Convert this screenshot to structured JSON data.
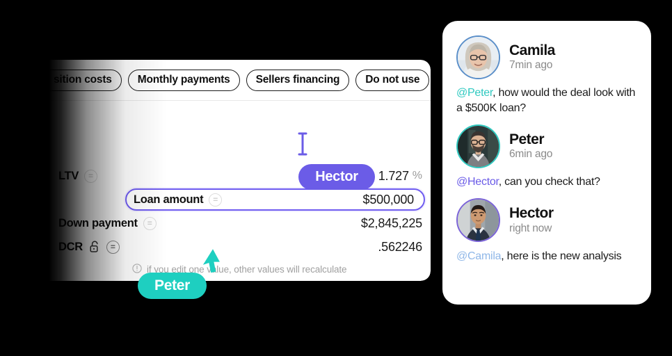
{
  "colors": {
    "accent_purple": "#6B5CE7",
    "accent_teal": "#1ECFC0",
    "mention_peter": "#2FC9C0",
    "mention_hector": "#6B5CE7",
    "mention_camila": "#8FB7E8",
    "panel_white": "#FFFFFF",
    "background": "#000000"
  },
  "calculator": {
    "tabs": [
      {
        "label": "sition costs",
        "full_label": "Acquisition costs",
        "clipped": true,
        "selected": false
      },
      {
        "label": "Monthly payments",
        "clipped": false,
        "selected": false
      },
      {
        "label": "Sellers financing",
        "clipped": false,
        "selected": false
      },
      {
        "label": "Do not use",
        "clipped": false,
        "selected": false
      }
    ],
    "collapse_icon": "chevron-up-icon",
    "rows": [
      {
        "label": "LTV",
        "value": "1.727",
        "unit": "%",
        "icon": "equals-circle-icon",
        "locked": false,
        "active": false
      },
      {
        "label": "Loan amount",
        "value": "$500,000",
        "unit": "",
        "icon": "equals-circle-icon",
        "locked": false,
        "active": true
      },
      {
        "label": "Down payment",
        "value": "$2,845,225",
        "unit": "",
        "icon": "equals-circle-icon",
        "locked": false,
        "active": false
      },
      {
        "label": "DCR",
        "value": ".562246",
        "unit": "",
        "icon": "equals-circle-icon",
        "locked": true,
        "lock_icon": "unlock-icon",
        "active": false
      }
    ],
    "hint": {
      "icon": "info-circle-icon",
      "text": "if you edit one value, other values will recalculate"
    }
  },
  "presence": {
    "hector_badge": {
      "name": "Hector",
      "color": "#6B5CE7",
      "cursor": "text-caret-icon"
    },
    "peter_badge": {
      "name": "Peter",
      "color": "#1ECFC0",
      "cursor": "arrow-pointer-icon"
    }
  },
  "comments": {
    "items": [
      {
        "name": "Camila",
        "time": "7min ago",
        "ring_color": "#5B8FC9",
        "avatar": "camila-avatar",
        "mention": "@Peter",
        "mention_color": "#2FC9C0",
        "text": ", how would the deal look with a $500K loan?"
      },
      {
        "name": "Peter",
        "time": "6min ago",
        "ring_color": "#2FC9C0",
        "avatar": "peter-avatar",
        "mention": "@Hector",
        "mention_color": "#6B5CE7",
        "text": ", can you check that?"
      },
      {
        "name": "Hector",
        "time": "right now",
        "ring_color": "#7B63D8",
        "avatar": "hector-avatar",
        "mention": "@Camila",
        "mention_color": "#8FB7E8",
        "text": ", here is the new analysis"
      }
    ]
  }
}
